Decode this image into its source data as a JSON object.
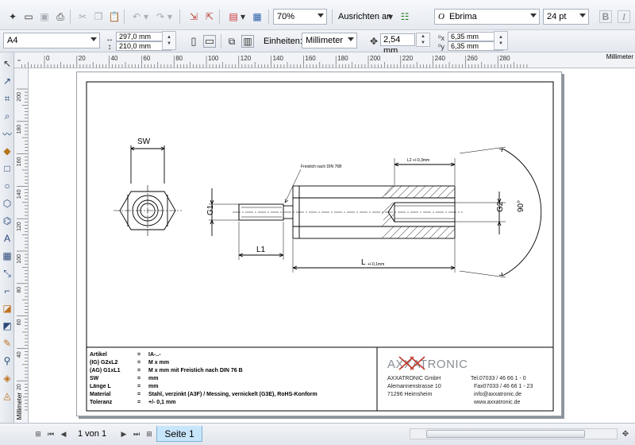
{
  "toolbar": {
    "zoom": "70%",
    "align_label": "Ausrichten an",
    "font_name": "Ebrima",
    "font_size": "24 pt",
    "bold": "B",
    "italic": "I"
  },
  "property_bar": {
    "page_size": "A4",
    "width": "297,0 mm",
    "height": "210,0 mm",
    "units_label": "Einheiten:",
    "units_value": "Millimeter",
    "nudge": "2,54 mm",
    "dup_x": "6,35 mm",
    "dup_y": "6,35 mm"
  },
  "rulers": {
    "h_ticks": [
      "20",
      "0",
      "20",
      "40",
      "60",
      "80",
      "100",
      "120",
      "140",
      "160",
      "180",
      "200",
      "220",
      "240",
      "260",
      "280"
    ],
    "h_unit": "Millimeter",
    "v_ticks": [
      "200",
      "180",
      "160",
      "140",
      "120",
      "100",
      "80",
      "60",
      "40",
      "20"
    ],
    "v_unit": "Millimeter"
  },
  "drawing": {
    "label_sw": "SW",
    "label_g1": "G1",
    "label_g2": "G2",
    "label_l1": "L1",
    "label_l": "L",
    "label_l_tol": "+/-0,1mm",
    "label_l2": "L2 +/-0,3mm",
    "label_freistich": "Freistich nach DIN 76B",
    "label_angle": "90°"
  },
  "title_block": {
    "rows": [
      {
        "key": "Artikel",
        "eq": "=",
        "val": "IA-..-"
      },
      {
        "key": "(IG)  G2xL2",
        "eq": "=",
        "val": "M x   mm"
      },
      {
        "key": "(AG)  G1xL1",
        "eq": "=",
        "val": "M x  mm mit Freistich nach DIN 76 B"
      },
      {
        "key": "SW",
        "eq": "=",
        "val": "mm"
      },
      {
        "key": "Länge L",
        "eq": "=",
        "val": "mm"
      },
      {
        "key": "Material",
        "eq": "=",
        "val": "Stahl, verzinkt (A3F) / Messing, vernickelt (G3E), RoHS-Konform"
      },
      {
        "key": "Toleranz",
        "eq": "=",
        "val": "+/- 0,1 mm"
      }
    ],
    "logo": "AXXATRONIC",
    "company": "AXXATRONIC GmbH",
    "street": "Alemannenstrasse 10",
    "city": "71296 Heimsheim",
    "tel": "Tel.07033 / 46 66 1 - 0",
    "fax": "Fax07033 / 46 66 1 - 23",
    "email": "info@axxatronic.de",
    "web": "www.axxatronic.de"
  },
  "bottom": {
    "page_counter": "1 von 1",
    "page_tab": "Seite 1"
  }
}
